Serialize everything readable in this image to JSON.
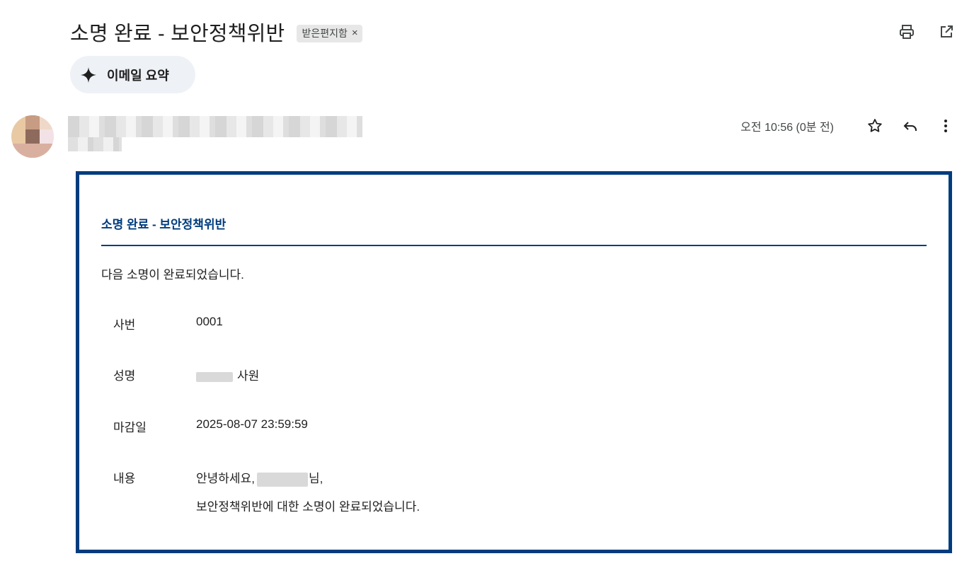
{
  "header": {
    "subject": "소명 완료 - 보안정책위반",
    "label": "받은편지함",
    "label_remove": "×"
  },
  "toolbar": {
    "print_icon": "print-icon",
    "open_new_window_icon": "open-in-new-icon"
  },
  "summary_button": {
    "label": "이메일 요약",
    "icon": "sparkle-icon"
  },
  "message_meta": {
    "time": "오전 10:56 (0분 전)",
    "star_icon": "star-icon",
    "reply_icon": "reply-icon",
    "more_icon": "more-vert-icon"
  },
  "mail": {
    "title": "소명 완료 - 보안정책위반",
    "intro": "다음 소명이 완료되었습니다.",
    "fields": [
      {
        "key": "사번",
        "value": "0001"
      },
      {
        "key": "성명",
        "value": "사원"
      },
      {
        "key": "마감일",
        "value": "2025-08-07 23:59:59"
      },
      {
        "key": "내용",
        "value": "님,",
        "value_prefix": "안녕하세요,",
        "line2": "보안정책위반에 대한 소명이 완료되었습니다."
      }
    ]
  },
  "colors": {
    "accent": "#003c7e",
    "chip_bg": "#e7e7e7",
    "summary_bg": "#eef1f6"
  }
}
